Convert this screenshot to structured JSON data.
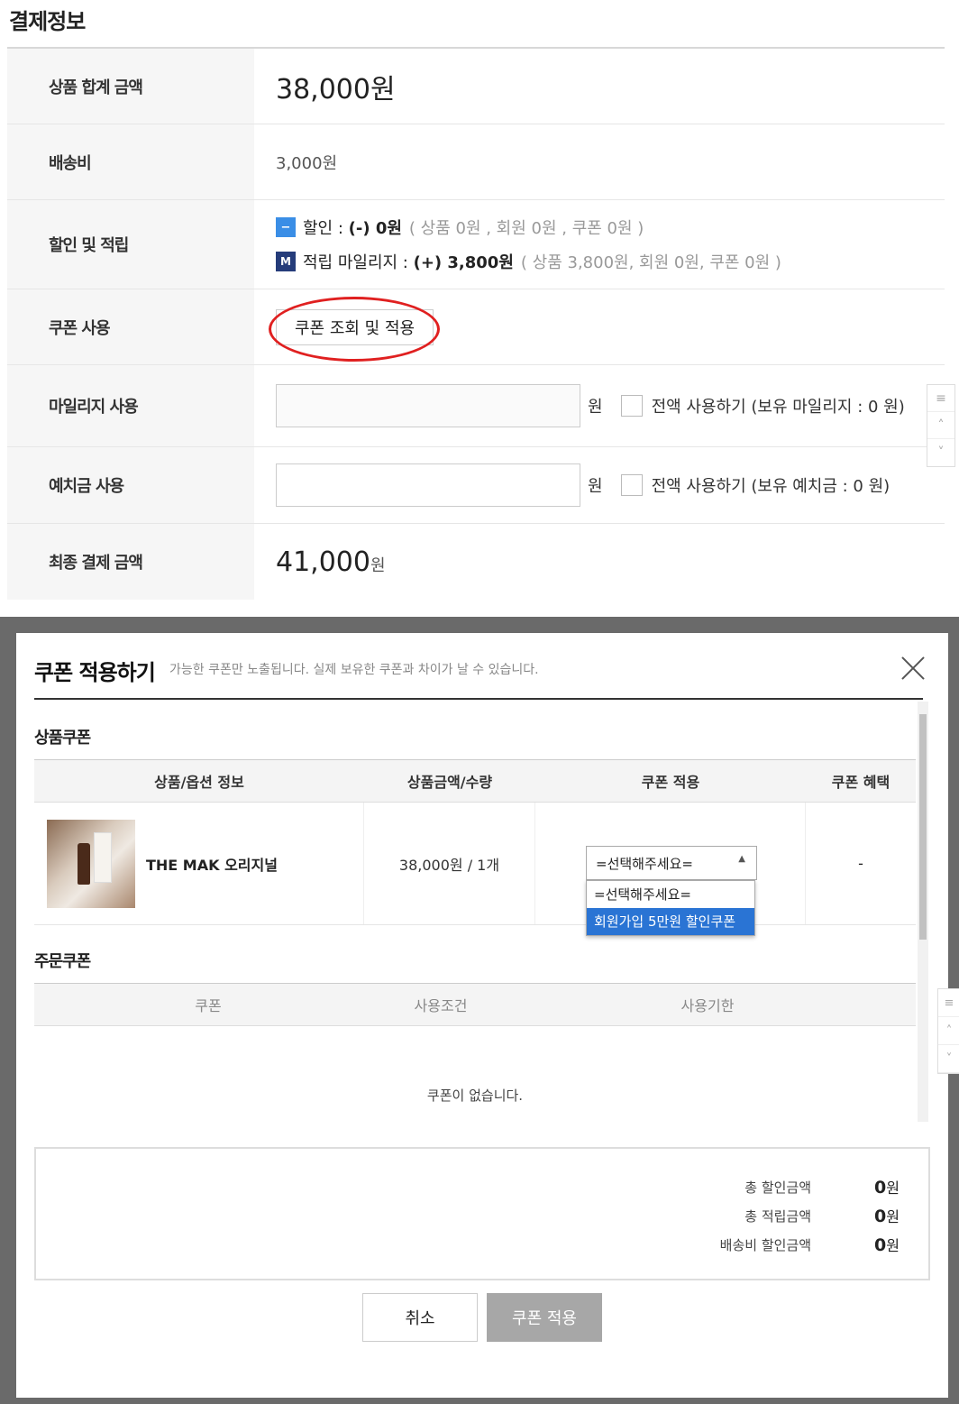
{
  "payment": {
    "title": "결제정보",
    "rows": {
      "subtotal_label": "상품 합계 금액",
      "subtotal_value": "38,000원",
      "shipping_label": "배송비",
      "shipping_value": "3,000원",
      "discount_label": "할인 및 적립",
      "discount_prefix": "할인 : ",
      "discount_amount": "(-) 0원",
      "discount_detail": "( 상품 0원 , 회원 0원 , 쿠폰 0원 )",
      "mileage_prefix": "적립 마일리지 : ",
      "mileage_amount": "(+) 3,800원",
      "mileage_detail": "( 상품 3,800원, 회원 0원, 쿠폰 0원 )",
      "coupon_label": "쿠폰 사용",
      "coupon_button": "쿠폰 조회 및 적용",
      "mileage_use_label": "마일리지 사용",
      "mileage_unit": "원",
      "mileage_all": "전액 사용하기 (보유 마일리지 : 0 원)",
      "deposit_use_label": "예치금 사용",
      "deposit_unit": "원",
      "deposit_all": "전액 사용하기 (보유 예치금 : 0 원)",
      "final_label": "최종 결제 금액",
      "final_value": "41,000",
      "final_unit": "원"
    },
    "badges": {
      "minus": "−",
      "m": "M"
    }
  },
  "modal": {
    "title": "쿠폰 적용하기",
    "subtitle": "가능한 쿠폰만 노출됩니다. 실제 보유한 쿠폰과 차이가 날 수 있습니다.",
    "product_coupon": {
      "title": "상품쿠폰",
      "headers": [
        "상품/옵션 정보",
        "상품금액/수량",
        "쿠폰 적용",
        "쿠폰 혜택"
      ],
      "product_name": "THE MAK 오리지널",
      "price_qty": "38,000원 / 1개",
      "select_value": "=선택해주세요=",
      "options": [
        "=선택해주세요=",
        "회원가입 5만원 할인쿠폰"
      ],
      "benefit": "-"
    },
    "order_coupon": {
      "title": "주문쿠폰",
      "headers": [
        "쿠폰",
        "사용조건",
        "사용기한"
      ],
      "empty": "쿠폰이 없습니다."
    },
    "summary": {
      "total_discount_label": "총 할인금액",
      "total_discount_value": "0",
      "total_mileage_label": "총 적립금액",
      "total_mileage_value": "0",
      "shipping_discount_label": "배송비 할인금액",
      "shipping_discount_value": "0",
      "unit": "원"
    },
    "buttons": {
      "cancel": "취소",
      "apply": "쿠폰 적용"
    }
  },
  "side_nav": [
    "≡",
    "˄",
    "˅"
  ],
  "colors": {
    "accent_blue": "#2a74d4",
    "badge_navy": "#253c7a",
    "highlight_red": "#e02020",
    "apply_disabled": "#a7a7a7"
  }
}
